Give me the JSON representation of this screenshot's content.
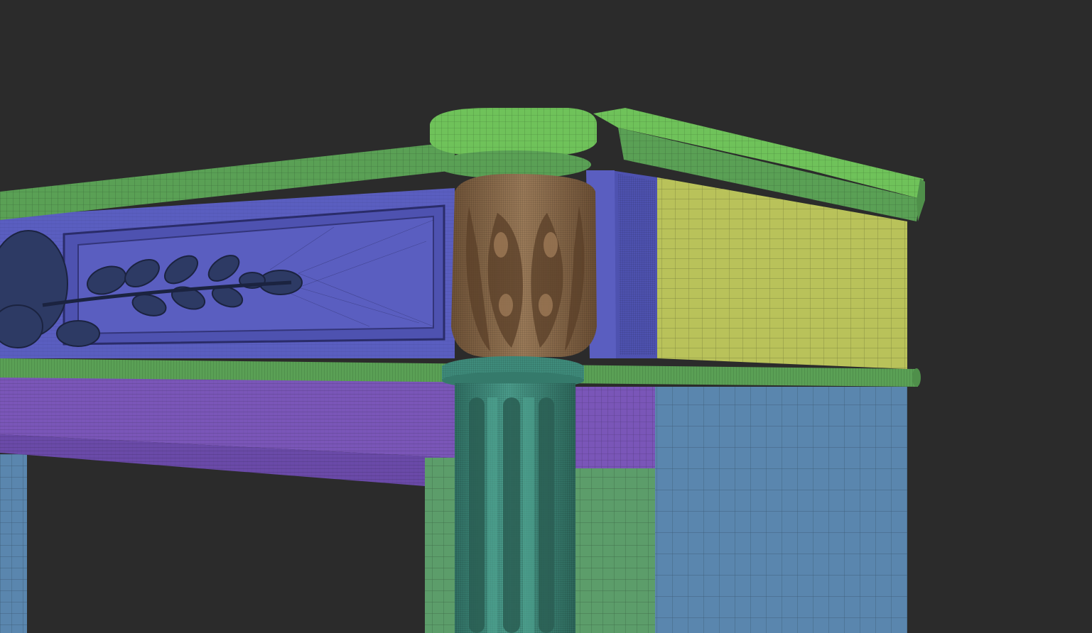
{
  "scene": {
    "subject": "mantel-mesh",
    "viewport_background": "#2b2b2b",
    "polygroup_colors": {
      "cornice": "#6fc25a",
      "frieze_panel": "#5a5ec0",
      "side_panel": "#b9c25a",
      "architrave": "#7a56b8",
      "jamb_front": "#5c9d6a",
      "jamb_side": "#5a86ae",
      "capital": "#8a6a4a",
      "column": "#3f8c7c",
      "garland": "#2d3a64",
      "wire": "#1a1a1a"
    }
  }
}
